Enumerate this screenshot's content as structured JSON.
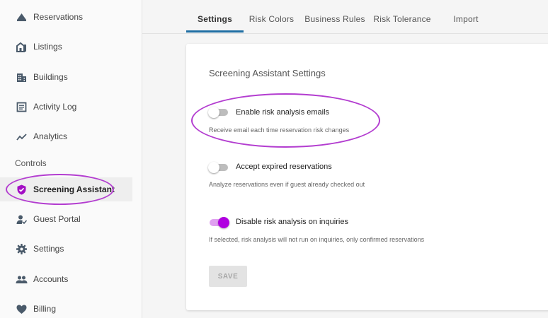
{
  "sidebar": {
    "items": [
      {
        "label": "Reservations",
        "icon": "reservations-icon"
      },
      {
        "label": "Listings",
        "icon": "listings-icon"
      },
      {
        "label": "Buildings",
        "icon": "buildings-icon"
      },
      {
        "label": "Activity Log",
        "icon": "activity-log-icon"
      },
      {
        "label": "Analytics",
        "icon": "analytics-icon"
      }
    ],
    "section_heading": "Controls",
    "controls": [
      {
        "label": "Screening Assistant",
        "icon": "shield-check-icon",
        "active": true
      },
      {
        "label": "Guest Portal",
        "icon": "guest-portal-icon"
      },
      {
        "label": "Settings",
        "icon": "gear-icon"
      },
      {
        "label": "Accounts",
        "icon": "accounts-icon"
      },
      {
        "label": "Billing",
        "icon": "heart-icon"
      }
    ]
  },
  "tabs": [
    {
      "label": "Settings",
      "active": true
    },
    {
      "label": "Risk Colors"
    },
    {
      "label": "Business Rules"
    },
    {
      "label": "Risk Tolerance"
    },
    {
      "label": "Import"
    }
  ],
  "card": {
    "title": "Screening Assistant Settings",
    "options": [
      {
        "label": "Enable risk analysis emails",
        "description": "Receive email each time reservation risk changes",
        "enabled": false
      },
      {
        "label": "Accept expired reservations",
        "description": "Analyze reservations even if guest already checked out",
        "enabled": false
      },
      {
        "label": "Disable risk analysis on inquiries",
        "description": "If selected, risk analysis will not run on inquiries, only confirmed reservations",
        "enabled": true
      }
    ],
    "save_label": "SAVE"
  },
  "colors": {
    "accent": "#b000e0",
    "tab_underline": "#1f6ea3",
    "annotation": "#b33dd0",
    "icon": "#4a5a6a"
  }
}
